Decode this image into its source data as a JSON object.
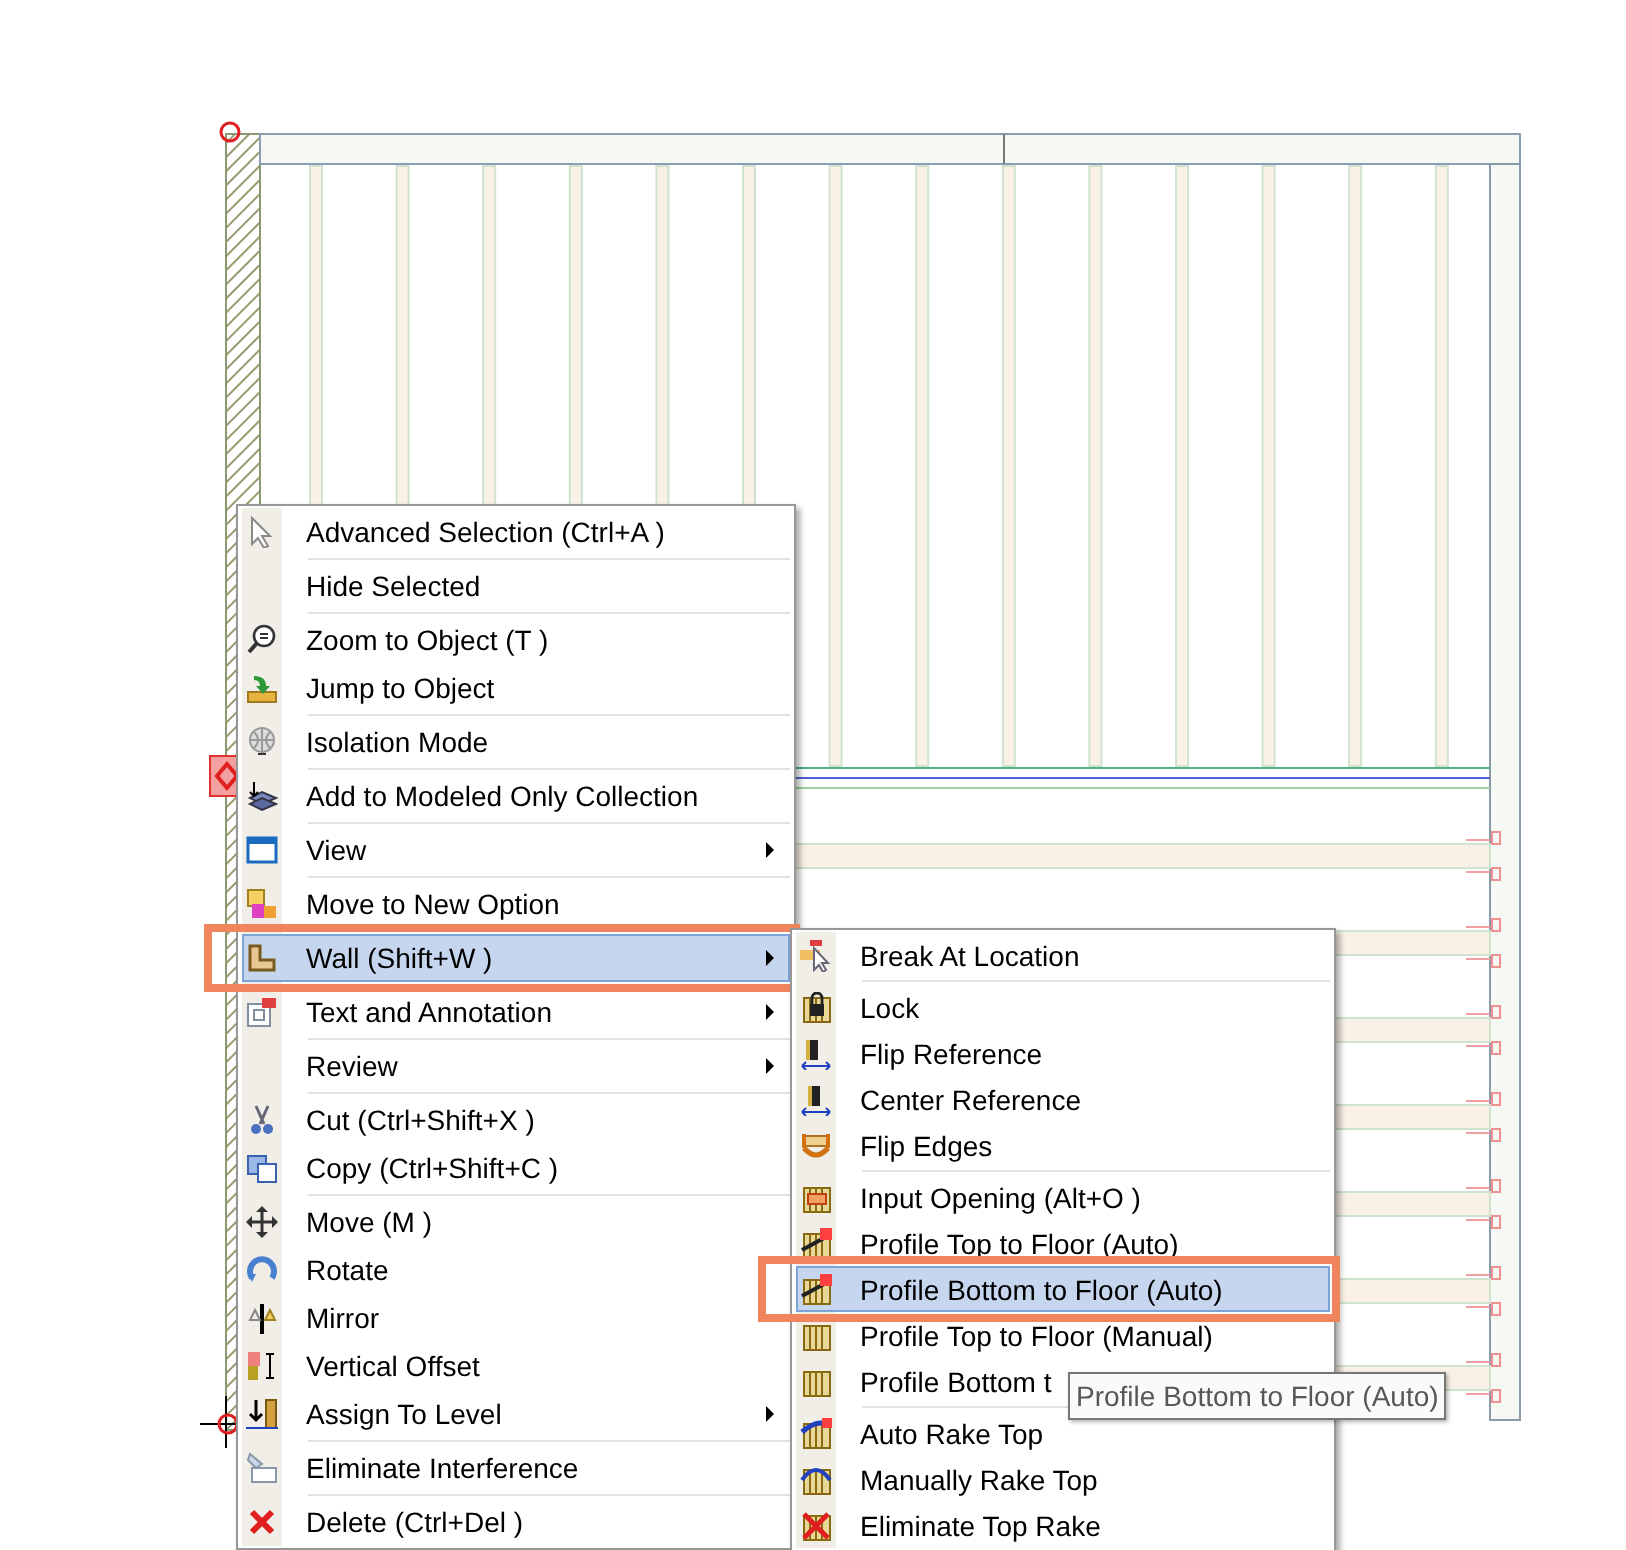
{
  "context_menu": {
    "items": [
      {
        "label": "Advanced Selection (Ctrl+A )",
        "divider_above": false,
        "has_submenu": false,
        "selected": false
      },
      {
        "label": "Hide Selected",
        "divider_above": true,
        "has_submenu": false,
        "selected": false
      },
      {
        "label": "Zoom to Object (T )",
        "divider_above": true,
        "has_submenu": false,
        "selected": false
      },
      {
        "label": "Jump to Object",
        "divider_above": false,
        "has_submenu": false,
        "selected": false
      },
      {
        "label": "Isolation Mode",
        "divider_above": true,
        "has_submenu": false,
        "selected": false
      },
      {
        "label": "Add to Modeled Only Collection",
        "divider_above": true,
        "has_submenu": false,
        "selected": false
      },
      {
        "label": "View",
        "divider_above": true,
        "has_submenu": true,
        "selected": false
      },
      {
        "label": "Move to New Option",
        "divider_above": true,
        "has_submenu": false,
        "selected": false
      },
      {
        "label": "Wall (Shift+W )",
        "divider_above": true,
        "has_submenu": true,
        "selected": true
      },
      {
        "label": "Text and Annotation",
        "divider_above": true,
        "has_submenu": true,
        "selected": false
      },
      {
        "label": "Review",
        "divider_above": true,
        "has_submenu": true,
        "selected": false
      },
      {
        "label": "Cut (Ctrl+Shift+X )",
        "divider_above": true,
        "has_submenu": false,
        "selected": false
      },
      {
        "label": "Copy (Ctrl+Shift+C )",
        "divider_above": false,
        "has_submenu": false,
        "selected": false
      },
      {
        "label": "Move (M )",
        "divider_above": true,
        "has_submenu": false,
        "selected": false
      },
      {
        "label": "Rotate",
        "divider_above": false,
        "has_submenu": false,
        "selected": false
      },
      {
        "label": "Mirror",
        "divider_above": false,
        "has_submenu": false,
        "selected": false
      },
      {
        "label": "Vertical Offset",
        "divider_above": false,
        "has_submenu": false,
        "selected": false
      },
      {
        "label": "Assign To Level",
        "divider_above": false,
        "has_submenu": true,
        "selected": false
      },
      {
        "label": "Eliminate Interference",
        "divider_above": true,
        "has_submenu": false,
        "selected": false
      },
      {
        "label": "Delete (Ctrl+Del )",
        "divider_above": true,
        "has_submenu": false,
        "selected": false
      }
    ]
  },
  "submenu": {
    "items": [
      {
        "label": "Break At Location",
        "divider_above": false,
        "selected": false
      },
      {
        "label": "Lock",
        "divider_above": true,
        "selected": false
      },
      {
        "label": "Flip Reference",
        "divider_above": false,
        "selected": false
      },
      {
        "label": "Center Reference",
        "divider_above": false,
        "selected": false
      },
      {
        "label": "Flip Edges",
        "divider_above": false,
        "selected": false
      },
      {
        "label": "Input Opening (Alt+O )",
        "divider_above": true,
        "selected": false
      },
      {
        "label": "Profile Top to Floor (Auto)",
        "divider_above": false,
        "selected": false
      },
      {
        "label": "Profile Bottom to Floor (Auto)",
        "divider_above": false,
        "selected": true
      },
      {
        "label": "Profile Top to Floor (Manual)",
        "divider_above": false,
        "selected": false
      },
      {
        "label": "Profile Bottom t",
        "divider_above": false,
        "selected": false
      },
      {
        "label": "Auto Rake Top",
        "divider_above": true,
        "selected": false
      },
      {
        "label": "Manually Rake Top",
        "divider_above": false,
        "selected": false
      },
      {
        "label": "Eliminate Top Rake",
        "divider_above": false,
        "selected": false
      }
    ]
  },
  "tooltip": {
    "text": "Profile Bottom to Floor (Auto)"
  }
}
